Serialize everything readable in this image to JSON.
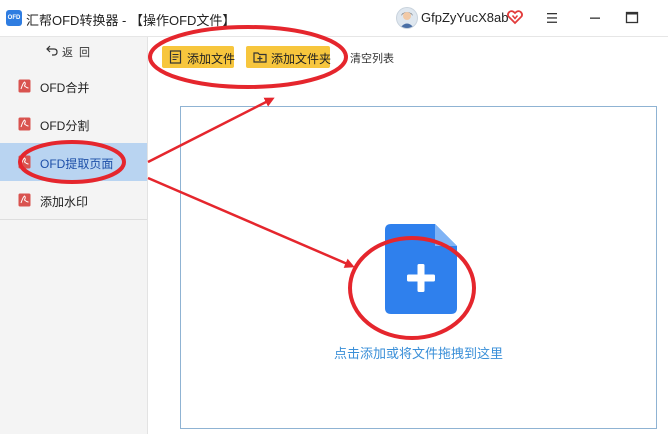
{
  "window": {
    "logo_text": "OFD",
    "title": "汇帮OFD转换器 - 【操作OFD文件】",
    "username": "GfpZyYucX8ab"
  },
  "icons": {
    "app": "ofd-logo-icon",
    "avatar": "user-avatar-icon",
    "vip": "vip-heart-icon",
    "menu": "hamburger-menu-icon",
    "minimize": "minimize-icon",
    "maximize": "maximize-icon",
    "back": "back-arrow-icon",
    "sidebar_item": "pdf-icon",
    "add_file": "add-file-icon",
    "add_folder": "add-folder-icon",
    "drop": "file-plus-icon"
  },
  "sidebar": {
    "back_label": "返回",
    "items": [
      {
        "label": "OFD合并"
      },
      {
        "label": "OFD分割"
      },
      {
        "label": "OFD提取页面"
      },
      {
        "label": "添加水印"
      }
    ]
  },
  "toolbar": {
    "add_file_label": "添加文件",
    "add_folder_label": "添加文件夹",
    "clear_list_label": "清空列表"
  },
  "dropzone": {
    "hint": "点击添加或将文件拖拽到这里"
  },
  "colors": {
    "accent_blue": "#2f80ed",
    "button_yellow": "#f7c63d",
    "active_item": "#b9d4f1",
    "annotation_red": "#e5262d",
    "pdf_red": "#d9534f"
  }
}
